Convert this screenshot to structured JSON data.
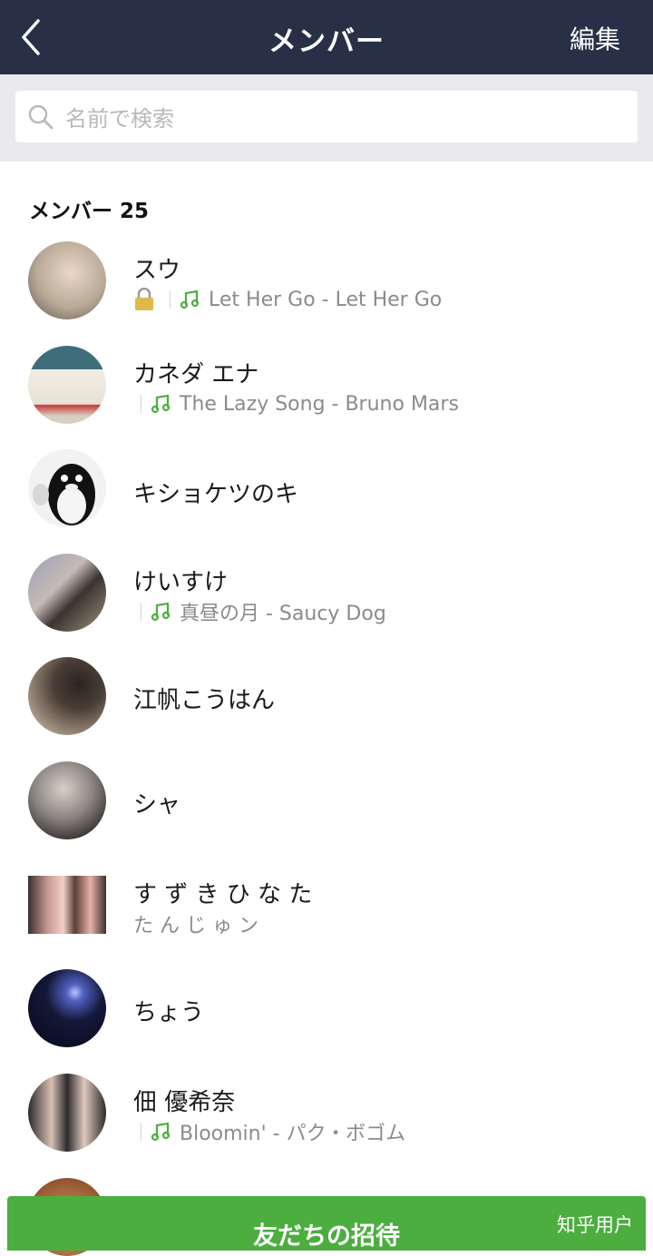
{
  "header": {
    "title": "メンバー",
    "edit_label": "編集"
  },
  "search": {
    "placeholder": "名前で検索"
  },
  "section": {
    "label": "メンバー 25"
  },
  "members": [
    {
      "name": "スウ",
      "lock": true,
      "song": "Let Her Go - Let Her Go"
    },
    {
      "name": "カネダ エナ",
      "song": "The Lazy Song - Bruno Mars"
    },
    {
      "name": "キショケツのキ"
    },
    {
      "name": "けいすけ",
      "song": "真昼の月 - Saucy Dog"
    },
    {
      "name": "江帆こうはん"
    },
    {
      "name": "シャ"
    },
    {
      "name": "す ず き ひ な た",
      "status": "た ん じ ゅ ン"
    },
    {
      "name": "ちょう"
    },
    {
      "name": "佃 優希奈",
      "song": "Bloomin' - パク・ボゴム"
    }
  ],
  "footer": {
    "invite_label": "友だちの招待",
    "watermark": "知乎用户"
  },
  "colors": {
    "navbar": "#283047",
    "accent_green": "#4cae3f",
    "search_bg": "#e9e9ee"
  }
}
